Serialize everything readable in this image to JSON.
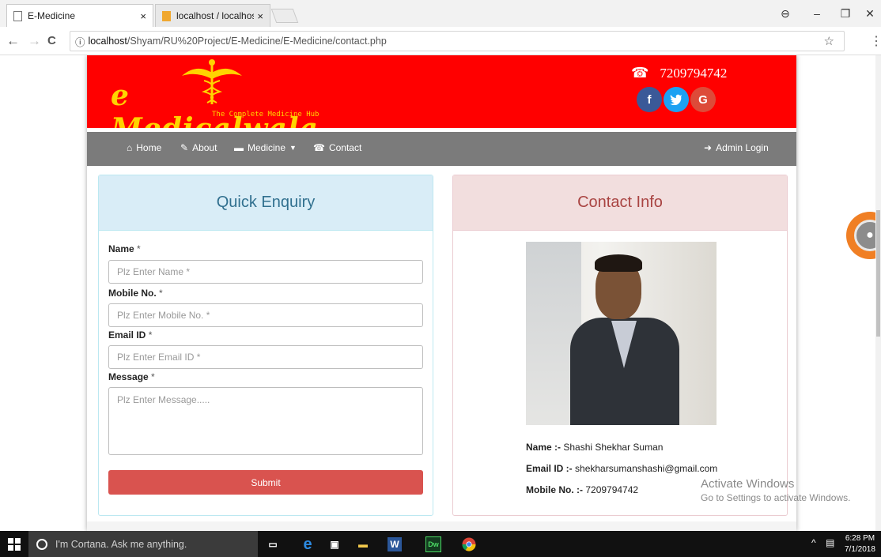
{
  "browser": {
    "tabs": [
      {
        "title": "E-Medicine",
        "close": "×"
      },
      {
        "title": "localhost / localhost / e_",
        "close": "×"
      }
    ],
    "url_host": "localhost",
    "url_path": "/Shyam/RU%20Project/E-Medicine/E-Medicine/contact.php",
    "back": "←",
    "forward": "→",
    "reload": "C",
    "info": "ⓘ",
    "bookmark": "☆",
    "menu": "⋮",
    "window_controls": {
      "account": "⊖",
      "minimize": "–",
      "maximize": "❐",
      "close": "✕"
    }
  },
  "site": {
    "logo_text": "e Medicalwala",
    "logo_tagline": "The Complete Medicine Hub",
    "phone": "7209794742",
    "social": {
      "facebook": "f",
      "twitter": "t",
      "google": "G"
    }
  },
  "nav": {
    "home": "Home",
    "about": "About",
    "medicine": "Medicine",
    "contact": "Contact",
    "admin": "Admin Login"
  },
  "enquiry": {
    "title": "Quick Enquiry",
    "name_label": "Name",
    "name_placeholder": "Plz Enter Name *",
    "mobile_label": "Mobile No.",
    "mobile_placeholder": "Plz Enter Mobile No. *",
    "email_label": "Email ID",
    "email_placeholder": "Plz Enter Email ID *",
    "message_label": "Message",
    "message_placeholder": "Plz Enter Message.....",
    "required_mark": "*",
    "submit": "Submit"
  },
  "contact_info": {
    "title": "Contact Info",
    "name_label": "Name :-",
    "name_value": "Shashi Shekhar Suman",
    "email_label": "Email ID :-",
    "email_value": "shekharsumanshashi@gmail.com",
    "mobile_label": "Mobile No. :-",
    "mobile_value": "7209794742"
  },
  "watermark": {
    "line1": "Activate Windows",
    "line2": "Go to Settings to activate Windows."
  },
  "taskbar": {
    "cortana": "I'm Cortana. Ask me anything.",
    "time": "6:28 PM",
    "date": "7/1/2018"
  },
  "colors": {
    "header_red": "#ff0000",
    "navbar_gray": "#7b7b7b",
    "submit_red": "#d9534f",
    "enquiry_head": "#d9edf7",
    "contact_head": "#f2dede"
  }
}
